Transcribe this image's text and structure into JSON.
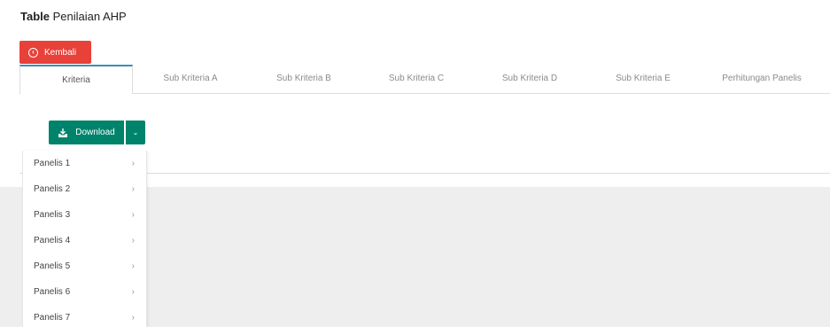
{
  "page": {
    "title_bold": "Table",
    "title_rest": " Penilaian AHP"
  },
  "back_button": {
    "label": "Kembali",
    "icon": "chevron-left-circle-icon",
    "color": "#e8413a"
  },
  "tabs": [
    {
      "label": "Kriteria",
      "active": true
    },
    {
      "label": "Sub Kriteria A",
      "active": false
    },
    {
      "label": "Sub Kriteria B",
      "active": false
    },
    {
      "label": "Sub Kriteria C",
      "active": false
    },
    {
      "label": "Sub Kriteria D",
      "active": false
    },
    {
      "label": "Sub Kriteria E",
      "active": false
    },
    {
      "label": "Perhitungan Panelis",
      "active": false
    }
  ],
  "download": {
    "label": "Download",
    "icon": "download-icon",
    "toggle_icon": "chevron-down-icon",
    "color": "#00836b"
  },
  "dropdown": {
    "items": [
      {
        "label": "Panelis 1",
        "icon": "chevron-right-icon"
      },
      {
        "label": "Panelis 2",
        "icon": "chevron-right-icon"
      },
      {
        "label": "Panelis 3",
        "icon": "chevron-right-icon"
      },
      {
        "label": "Panelis 4",
        "icon": "chevron-right-icon"
      },
      {
        "label": "Panelis 5",
        "icon": "chevron-right-icon"
      },
      {
        "label": "Panelis 6",
        "icon": "chevron-right-icon"
      },
      {
        "label": "Panelis 7",
        "icon": "chevron-right-icon"
      }
    ]
  }
}
